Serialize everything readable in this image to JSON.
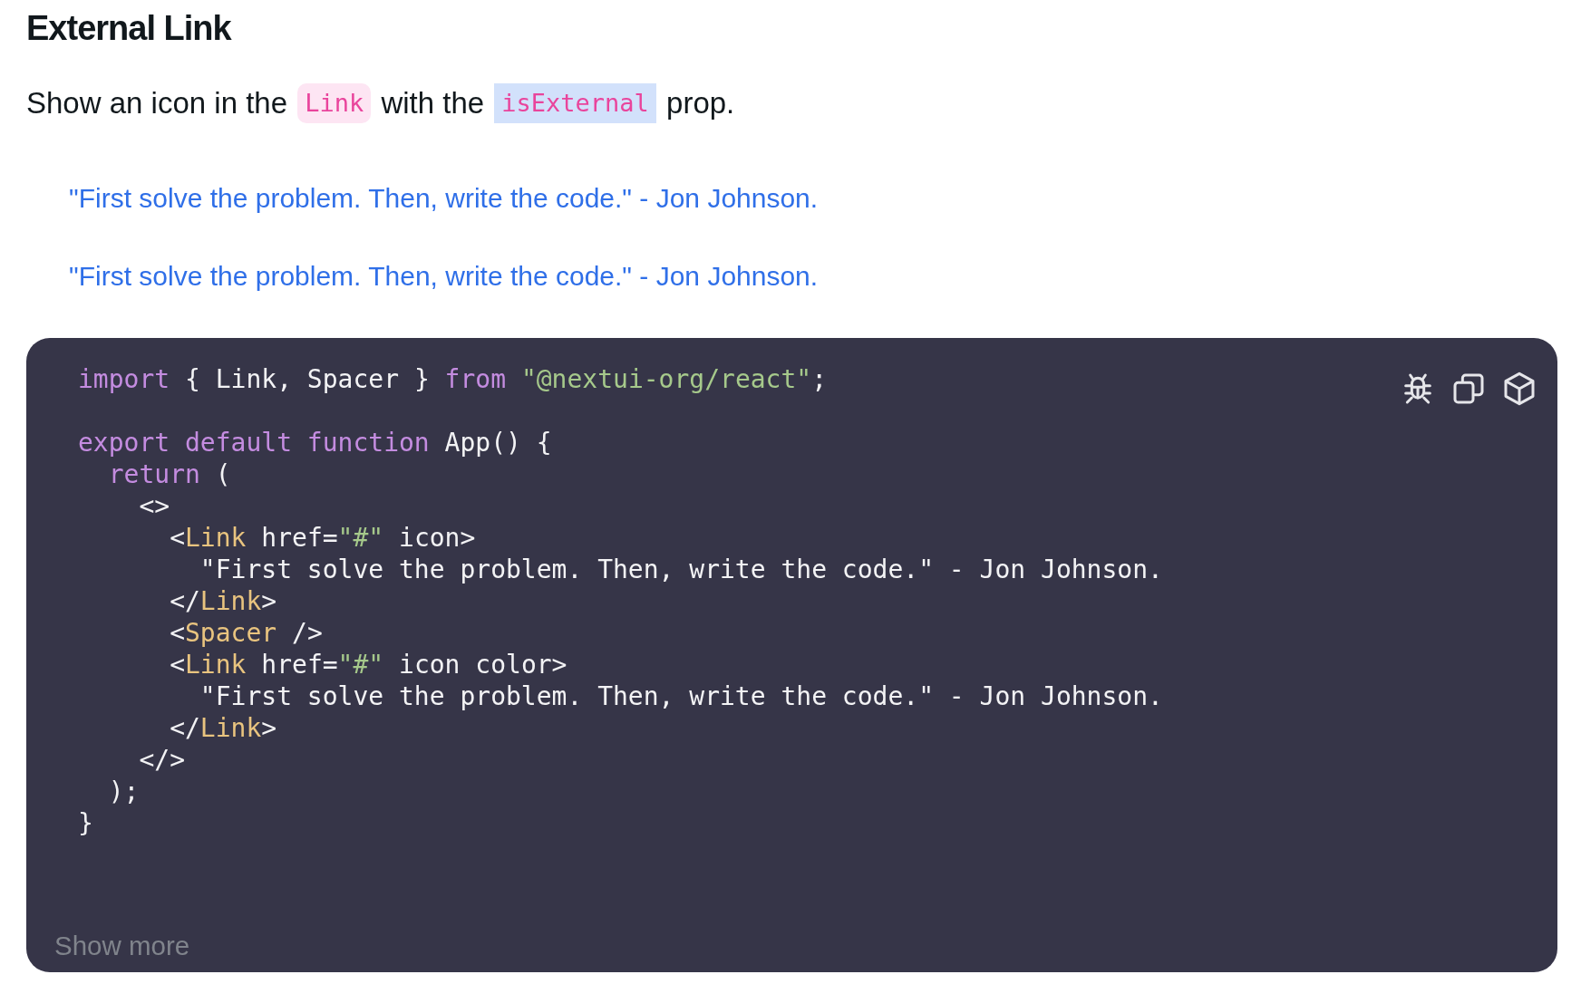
{
  "heading": "External Link",
  "description": [
    {
      "kind": "text",
      "text": "Show an icon in the "
    },
    {
      "kind": "code",
      "text": "Link",
      "highlighted": false
    },
    {
      "kind": "text",
      "text": " with the "
    },
    {
      "kind": "code",
      "text": "isExternal",
      "highlighted": true
    },
    {
      "kind": "text",
      "text": " prop."
    }
  ],
  "links": [
    "\"First solve the problem. Then, write the code.\" - Jon Johnson.",
    "\"First solve the problem. Then, write the code.\" - Jon Johnson."
  ],
  "code_block": {
    "lines": [
      {
        "kind": "code",
        "tokens": [
          {
            "kind": "keyword",
            "text": "import"
          },
          {
            "kind": "plain",
            "text": " { Link, Spacer } "
          },
          {
            "kind": "keyword",
            "text": "from "
          },
          {
            "kind": "string",
            "text": "\"@nextui-org/react\""
          },
          {
            "kind": "plain",
            "text": ";"
          }
        ]
      },
      {
        "kind": "blank"
      },
      {
        "kind": "code",
        "tokens": [
          {
            "kind": "keyword",
            "text": "export default function"
          },
          {
            "kind": "plain",
            "text": " App() {"
          }
        ]
      },
      {
        "kind": "code",
        "tokens": [
          {
            "kind": "keyword",
            "text": "  return"
          },
          {
            "kind": "plain",
            "text": " ("
          }
        ]
      },
      {
        "kind": "code",
        "tokens": [
          {
            "kind": "plain",
            "text": "    <>"
          }
        ]
      },
      {
        "kind": "code",
        "tokens": [
          {
            "kind": "plain",
            "text": "      <"
          },
          {
            "kind": "tag",
            "text": "Link"
          },
          {
            "kind": "plain",
            "text": " href="
          },
          {
            "kind": "string",
            "text": "\"#\""
          },
          {
            "kind": "plain",
            "text": " icon>"
          }
        ]
      },
      {
        "kind": "code",
        "tokens": [
          {
            "kind": "plain",
            "text": "        \"First solve the problem. Then, write the code.\" - Jon Johnson."
          }
        ]
      },
      {
        "kind": "code",
        "tokens": [
          {
            "kind": "plain",
            "text": "      </"
          },
          {
            "kind": "tag",
            "text": "Link"
          },
          {
            "kind": "plain",
            "text": ">"
          }
        ]
      },
      {
        "kind": "code",
        "tokens": [
          {
            "kind": "plain",
            "text": "      <"
          },
          {
            "kind": "tag",
            "text": "Spacer"
          },
          {
            "kind": "plain",
            "text": " />"
          }
        ]
      },
      {
        "kind": "code",
        "tokens": [
          {
            "kind": "plain",
            "text": "      <"
          },
          {
            "kind": "tag",
            "text": "Link"
          },
          {
            "kind": "plain",
            "text": " href="
          },
          {
            "kind": "string",
            "text": "\"#\""
          },
          {
            "kind": "plain",
            "text": " icon color>"
          }
        ]
      },
      {
        "kind": "code",
        "tokens": [
          {
            "kind": "plain",
            "text": "        \"First solve the problem. Then, write the code.\" - Jon Johnson."
          }
        ]
      },
      {
        "kind": "code",
        "tokens": [
          {
            "kind": "plain",
            "text": "      </"
          },
          {
            "kind": "tag",
            "text": "Link"
          },
          {
            "kind": "plain",
            "text": ">"
          }
        ]
      },
      {
        "kind": "code",
        "tokens": [
          {
            "kind": "plain",
            "text": "    </>"
          }
        ]
      },
      {
        "kind": "code",
        "tokens": [
          {
            "kind": "plain",
            "text": "  );"
          }
        ]
      },
      {
        "kind": "code",
        "tokens": [
          {
            "kind": "plain",
            "text": "}"
          }
        ]
      }
    ],
    "show_more": "Show more"
  }
}
